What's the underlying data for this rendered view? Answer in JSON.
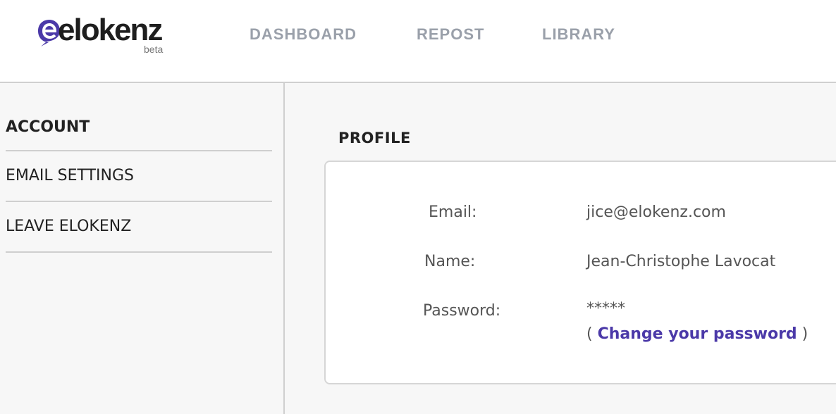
{
  "brand": {
    "name": "elokenz",
    "badge": "beta",
    "accent": "#4b39a8"
  },
  "nav": {
    "items": [
      {
        "label": "DASHBOARD"
      },
      {
        "label": "REPOST"
      },
      {
        "label": "LIBRARY"
      }
    ]
  },
  "sidebar": {
    "items": [
      {
        "label": "ACCOUNT",
        "active": true
      },
      {
        "label": "EMAIL SETTINGS",
        "active": false
      },
      {
        "label": "LEAVE ELOKENZ",
        "active": false
      }
    ]
  },
  "profile": {
    "title": "PROFILE",
    "email_label": "Email:",
    "email_value": "jice@elokenz.com",
    "name_label": "Name:",
    "name_value": "Jean-Christophe Lavocat",
    "password_label": "Password:",
    "password_value": "*****",
    "change_open": "( ",
    "change_link": "Change your password",
    "change_close": " )"
  }
}
